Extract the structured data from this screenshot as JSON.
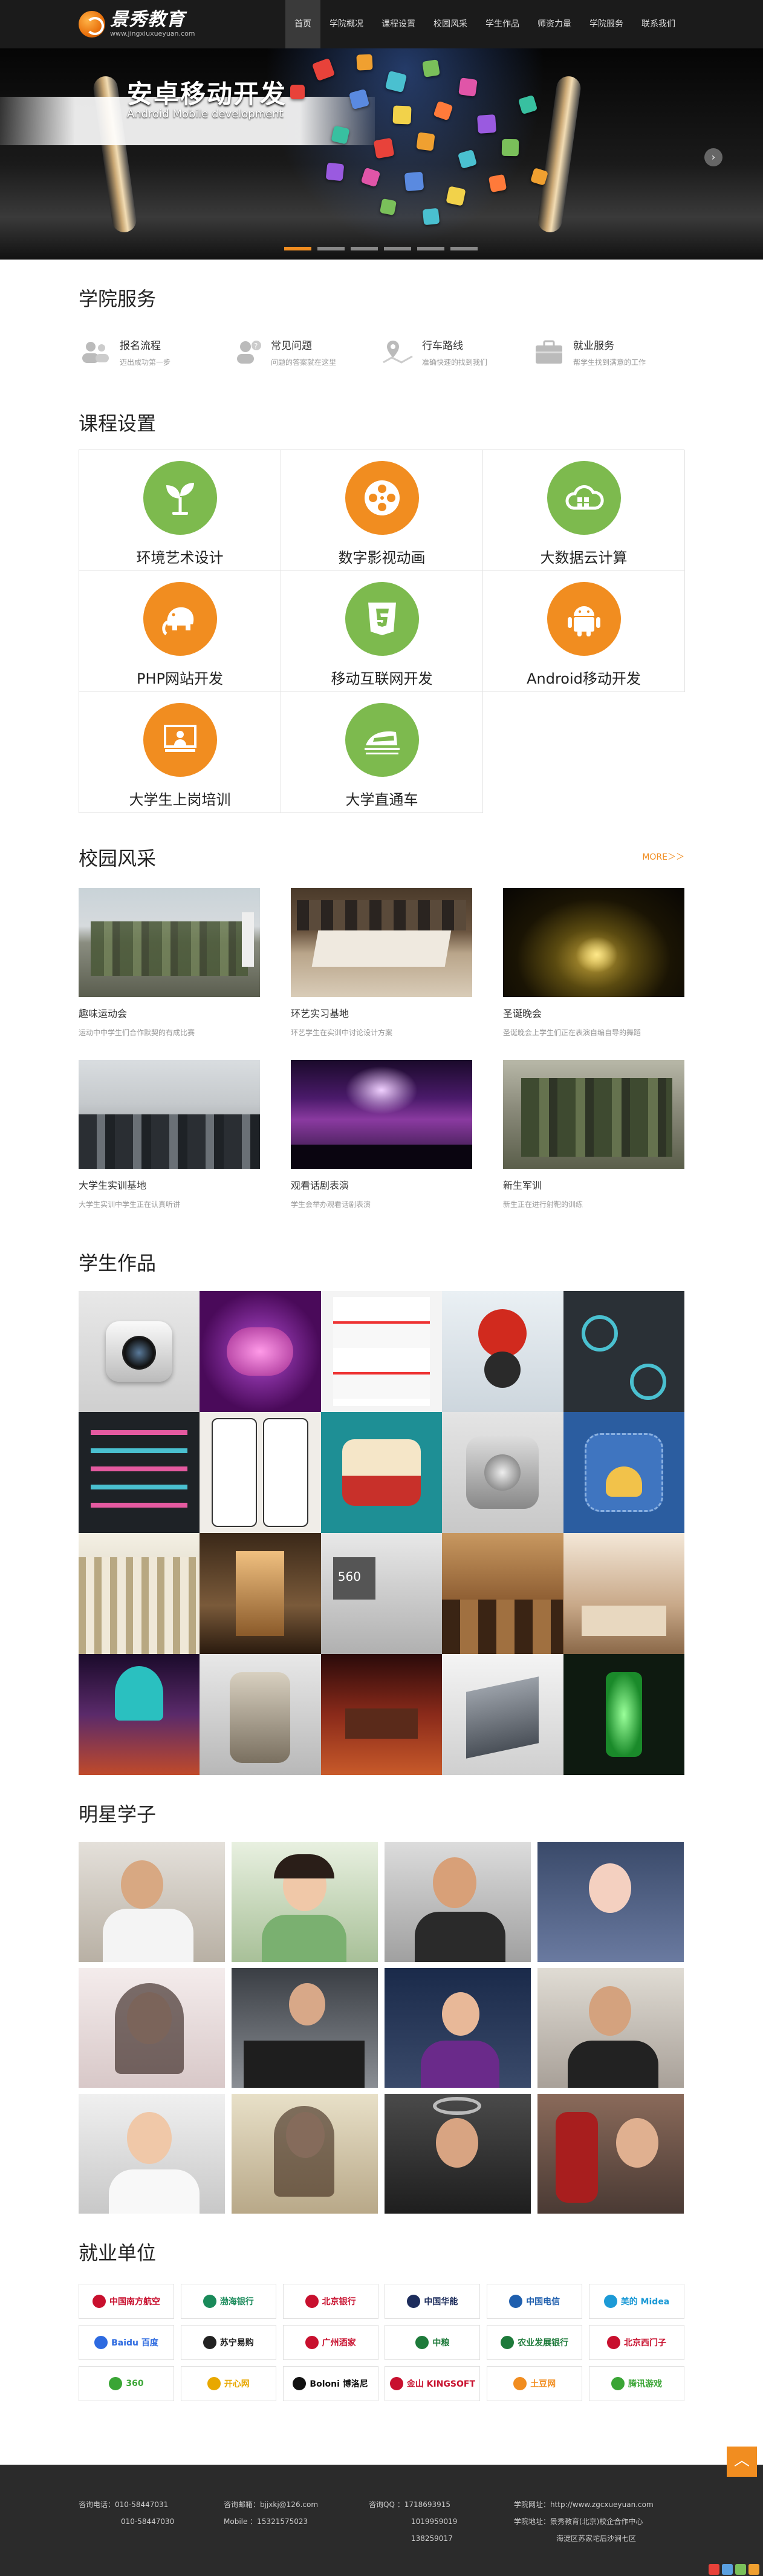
{
  "nav": {
    "logo_text": "景秀教育",
    "logo_url": "www.jingxiuxueyuan.com",
    "items": [
      {
        "label": "首页",
        "active": true
      },
      {
        "label": "学院概况"
      },
      {
        "label": "课程设置"
      },
      {
        "label": "校园风采"
      },
      {
        "label": "学生作品"
      },
      {
        "label": "师资力量"
      },
      {
        "label": "学院服务"
      },
      {
        "label": "联系我们"
      }
    ]
  },
  "banner": {
    "title": "安卓移动开发",
    "subtitle": "Android Mobile development",
    "arrow": "›",
    "dots": 6,
    "active_dot": 0
  },
  "services": {
    "title": "学院服务",
    "items": [
      {
        "name": "报名流程",
        "desc": "迈出成功第一步",
        "icon": "users-icon"
      },
      {
        "name": "常见问题",
        "desc": "问题的答案就在这里",
        "icon": "question-icon"
      },
      {
        "name": "行车路线",
        "desc": "准确快速的找到我们",
        "icon": "route-icon"
      },
      {
        "name": "就业服务",
        "desc": "帮学生找到满意的工作",
        "icon": "briefcase-icon"
      }
    ]
  },
  "courses": {
    "title": "课程设置",
    "items": [
      {
        "name": "环境艺术设计",
        "icon": "sprout-icon",
        "color": "green"
      },
      {
        "name": "数字影视动画",
        "icon": "film-reel-icon",
        "color": "orange"
      },
      {
        "name": "大数据云计算",
        "icon": "cloud-icon",
        "color": "green"
      },
      {
        "name": "PHP网站开发",
        "icon": "elephant-icon",
        "color": "orange"
      },
      {
        "name": "移动互联网开发",
        "icon": "html5-icon",
        "color": "green"
      },
      {
        "name": "Android移动开发",
        "icon": "android-icon",
        "color": "orange"
      },
      {
        "name": "大学生上岗培训",
        "icon": "presentation-icon",
        "color": "orange"
      },
      {
        "name": "大学直通车",
        "icon": "train-icon",
        "color": "green"
      }
    ]
  },
  "campus": {
    "title": "校园风采",
    "more": "MORE＞＞",
    "items": [
      {
        "name": "趣味运动会",
        "desc": "运动中中学生们合作默契的有成比赛"
      },
      {
        "name": "环艺实习基地",
        "desc": "环艺学生在实训中讨论设计方案"
      },
      {
        "name": "圣诞晚会",
        "desc": "圣诞晚会上学生们正在表演自编自导的舞蹈"
      },
      {
        "name": "大学生实训基地",
        "desc": "大学生实训中学生正在认真听讲"
      },
      {
        "name": "观看话剧表演",
        "desc": "学生会举办观看话剧表演"
      },
      {
        "name": "新生军训",
        "desc": "新生正在进行射靶的训练"
      }
    ]
  },
  "works": {
    "title": "学生作品",
    "count": 20
  },
  "stars": {
    "title": "明星学子",
    "count": 12
  },
  "employers": {
    "title": "就业单位",
    "items": [
      {
        "name": "中国南方航空",
        "color": "#c8102e"
      },
      {
        "name": "渤海银行",
        "color": "#1a8a5a"
      },
      {
        "name": "北京银行",
        "color": "#c8102e"
      },
      {
        "name": "中国华能",
        "color": "#1d2d5c"
      },
      {
        "name": "中国电信",
        "color": "#1f5fae"
      },
      {
        "name": "美的 Midea",
        "color": "#1d9ad6"
      },
      {
        "name": "Baidu 百度",
        "color": "#2d6ae0"
      },
      {
        "name": "苏宁易购",
        "color": "#222222"
      },
      {
        "name": "广州酒家",
        "color": "#c8102e"
      },
      {
        "name": "中粮",
        "color": "#1d7a3a"
      },
      {
        "name": "农业发展银行",
        "color": "#1d7a3a"
      },
      {
        "name": "北京西门子",
        "color": "#c8102e"
      },
      {
        "name": "360",
        "color": "#3aa535"
      },
      {
        "name": "开心网",
        "color": "#e8a800"
      },
      {
        "name": "Boloni 博洛尼",
        "color": "#111111"
      },
      {
        "name": "金山 KINGSOFT",
        "color": "#c8102e"
      },
      {
        "name": "土豆网",
        "color": "#f18d20"
      },
      {
        "name": "腾讯游戏",
        "color": "#3aa535"
      }
    ]
  },
  "footer": {
    "col1": [
      "咨询电话：010-58447031",
      "010-58447030"
    ],
    "col2": [
      "咨询邮箱：bjjxkj@126.com",
      "Mobile ：15321575023"
    ],
    "col3": [
      "咨询QQ ：1718693915",
      "1019959019",
      "138259017"
    ],
    "col4": [
      "学院网址：http://www.zgcxueyuan.com",
      "学院地址：景秀教育(北京)校企合作中心",
      "海淀区苏家坨后沙涧七区"
    ],
    "top": "︿"
  }
}
